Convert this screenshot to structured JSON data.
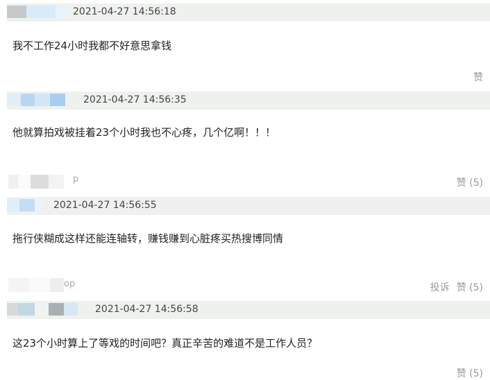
{
  "comments": [
    {
      "timestamp": "2021-04-27 14:56:18",
      "text": "我不工作24小时我都不好意思拿钱",
      "actions": {
        "like_label": "赞"
      }
    },
    {
      "timestamp": "2021-04-27 14:56:35",
      "text": "他就算拍戏被挂着23个小时我也不心疼，几个亿啊！！！",
      "actions": {
        "like_label": "赞 (5)"
      },
      "extra_text": "p"
    },
    {
      "timestamp": "2021-04-27 14:56:55",
      "text": "拖行侠糊成这样还能连轴转，赚钱赚到心脏疼买热搜博同情",
      "actions": {
        "report_label": "投诉",
        "like_label": "赞 (5)"
      },
      "extra_text": "op"
    },
    {
      "timestamp": "2021-04-27 14:56:58",
      "text": "这23个小时算上了等戏的时间吧？真正辛苦的难道不是工作人员？",
      "actions": {
        "like_label": "赞 (5)"
      }
    }
  ],
  "colors": {
    "header_bg": "#eef1ee",
    "action_text": "#999999",
    "blur_blue": "#c8e0f4",
    "blur_grey": "#c9ccce"
  }
}
